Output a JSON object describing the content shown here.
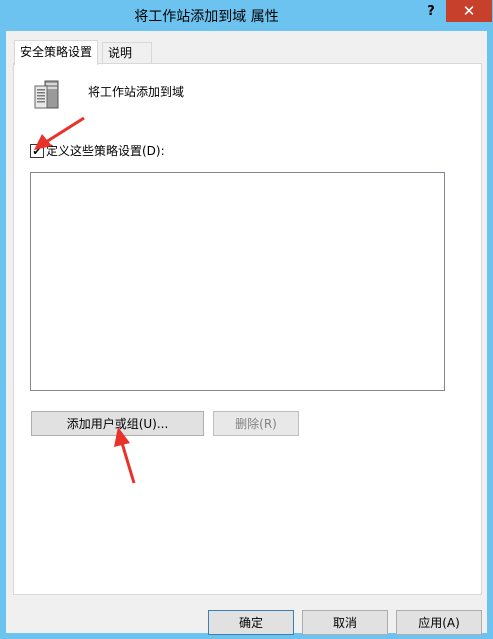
{
  "window": {
    "title": "将工作站添加到域 属性",
    "help_glyph": "?",
    "close_glyph": "✕"
  },
  "tabs": [
    {
      "label": "安全策略设置"
    },
    {
      "label": "说明"
    }
  ],
  "policy": {
    "icon": "server-icon",
    "name": "将工作站添加到域"
  },
  "define_checkbox": {
    "label": "定义这些策略设置(D):",
    "checked": true,
    "check_glyph": "✔"
  },
  "buttons": {
    "add": "添加用户或组(U)...",
    "remove": "删除(R)",
    "ok": "确定",
    "cancel": "取消",
    "apply": "应用(A)"
  },
  "annotation_color": "#e8322a"
}
